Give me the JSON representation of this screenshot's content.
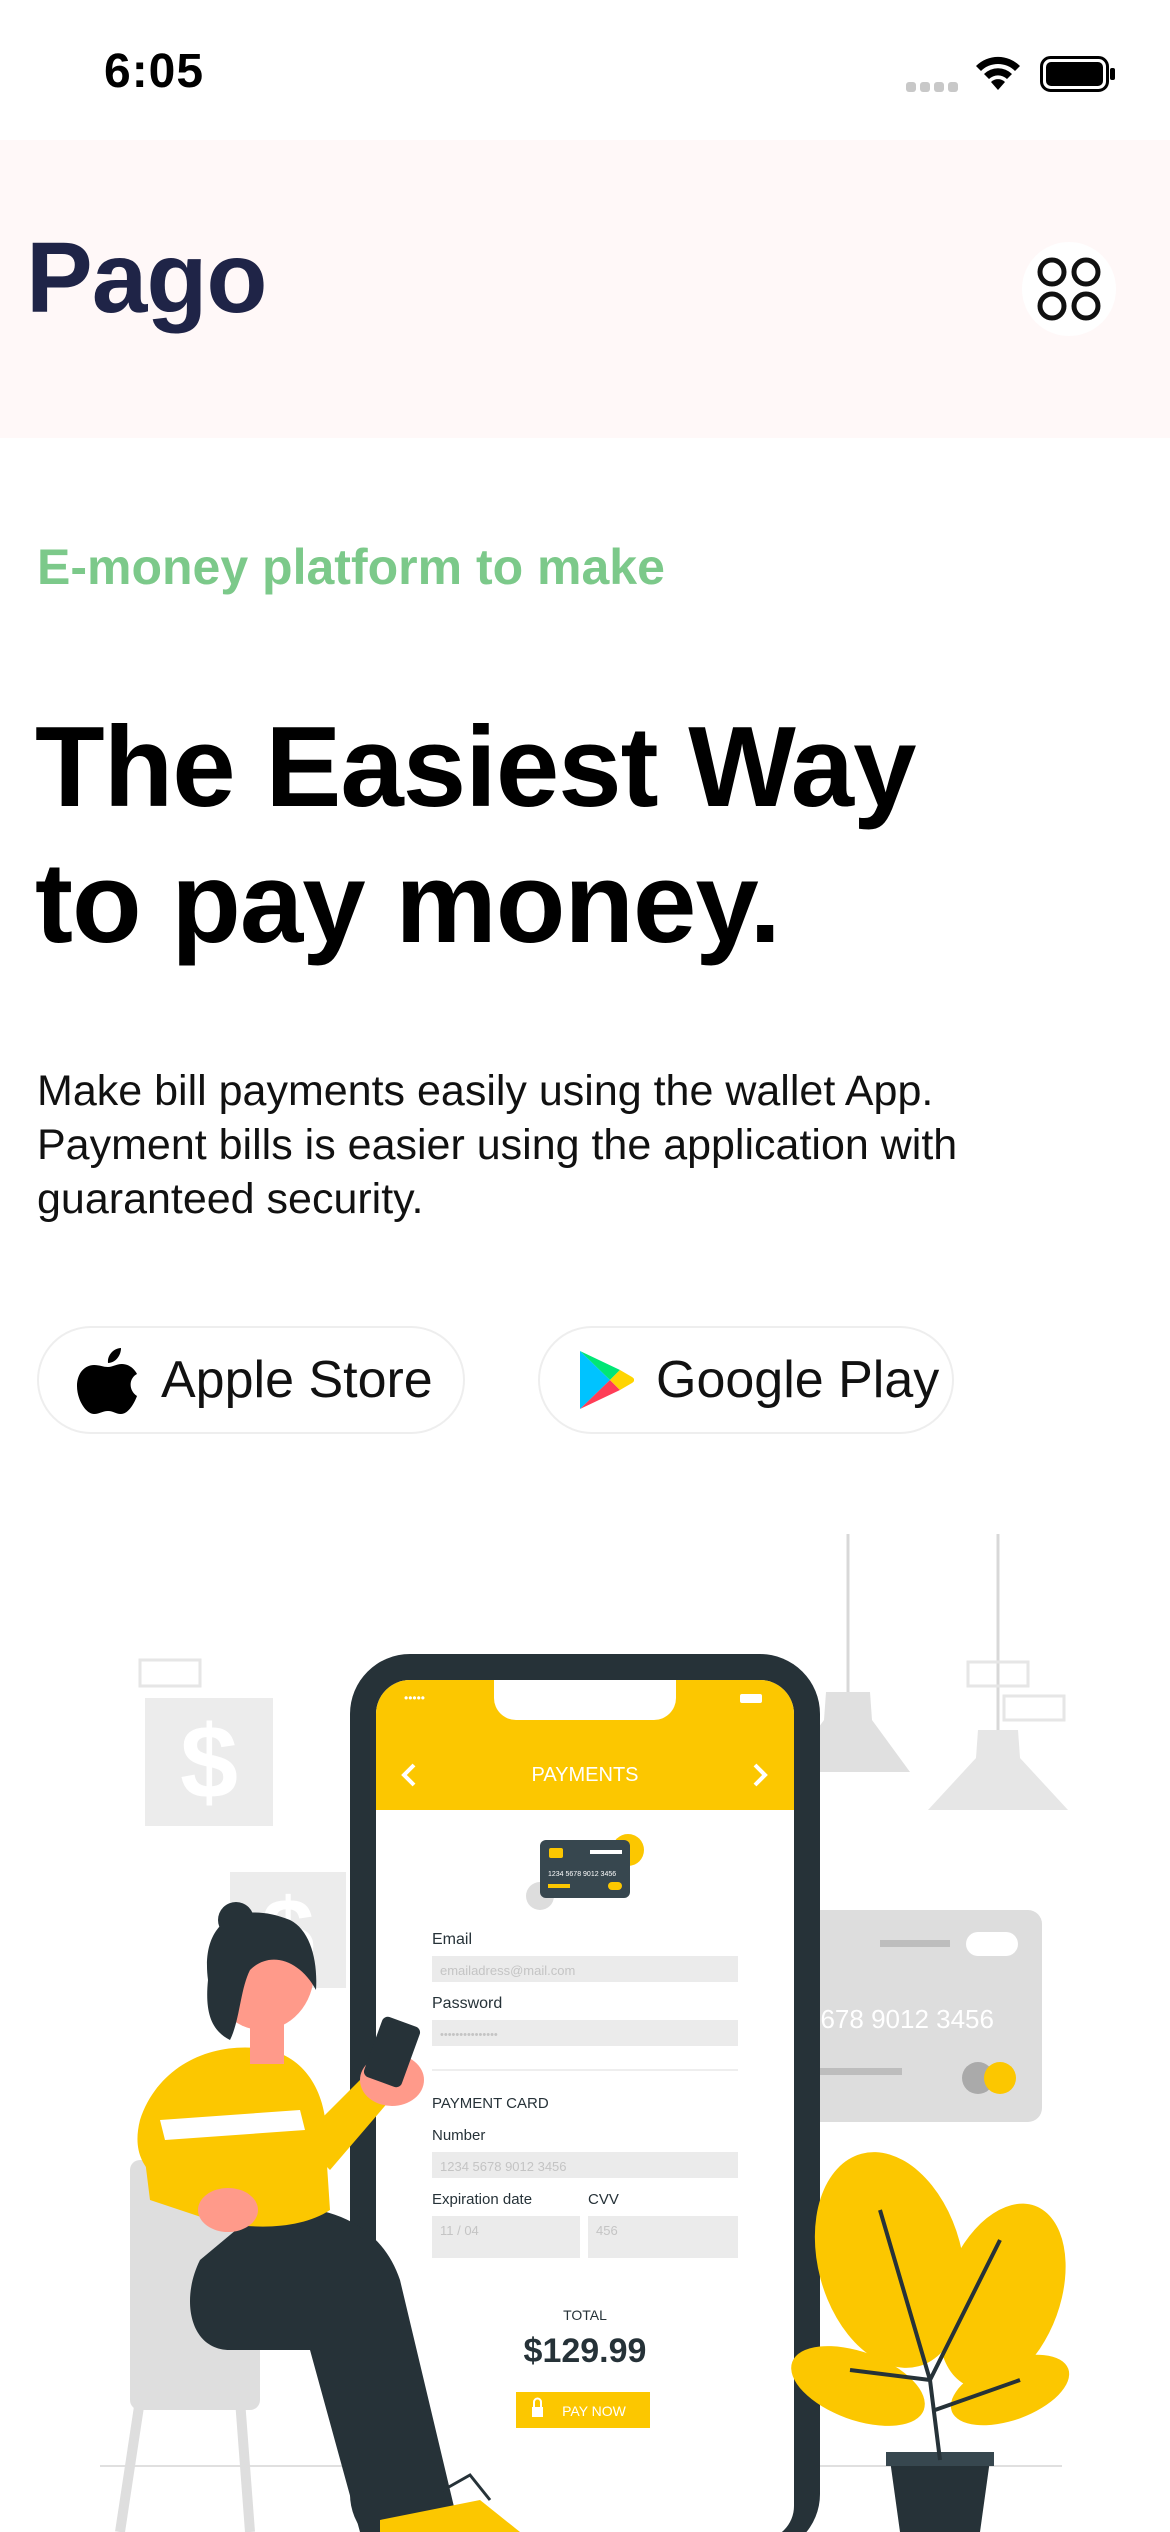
{
  "status_bar": {
    "time": "6:05"
  },
  "header": {
    "logo": "Pago",
    "menu_icon": "grid-icon"
  },
  "hero": {
    "tagline": "E-money platform to make",
    "title_line1": "The Easiest Way",
    "title_line2": "to pay money.",
    "description_lines": [
      "Make bill payments easily using the wallet App.",
      "Payment bills is easier using the application with",
      "guaranteed security."
    ]
  },
  "store_buttons": [
    {
      "label": "Apple Store",
      "icon": "apple-icon"
    },
    {
      "label": "Google Play",
      "icon": "google-play-icon"
    }
  ],
  "illustration": {
    "phone_screen_title": "PAYMENTS",
    "email_label": "Email",
    "email_placeholder": "emailadress@mail.com",
    "password_label": "Password",
    "password_placeholder": "•••••••••••••••",
    "card_section_label": "PAYMENT CARD",
    "number_label": "Number",
    "number_placeholder": "1234 5678 9012 3456",
    "expiration_label": "Expiration date",
    "expiration_placeholder": "11 / 04",
    "cvv_label": "CVV",
    "cvv_placeholder": "456",
    "total_label": "TOTAL",
    "total_value": "$129.99",
    "pay_button": "PAY NOW",
    "card_number_bg": "5678  9012  3456",
    "mini_card_number": "1234 5678 9012 3456",
    "dollar_sign": "$",
    "colors": {
      "accent": "#fcc700",
      "phone_frame": "#263238",
      "tagline": "#7cc98a",
      "logo": "#1f2447"
    }
  }
}
